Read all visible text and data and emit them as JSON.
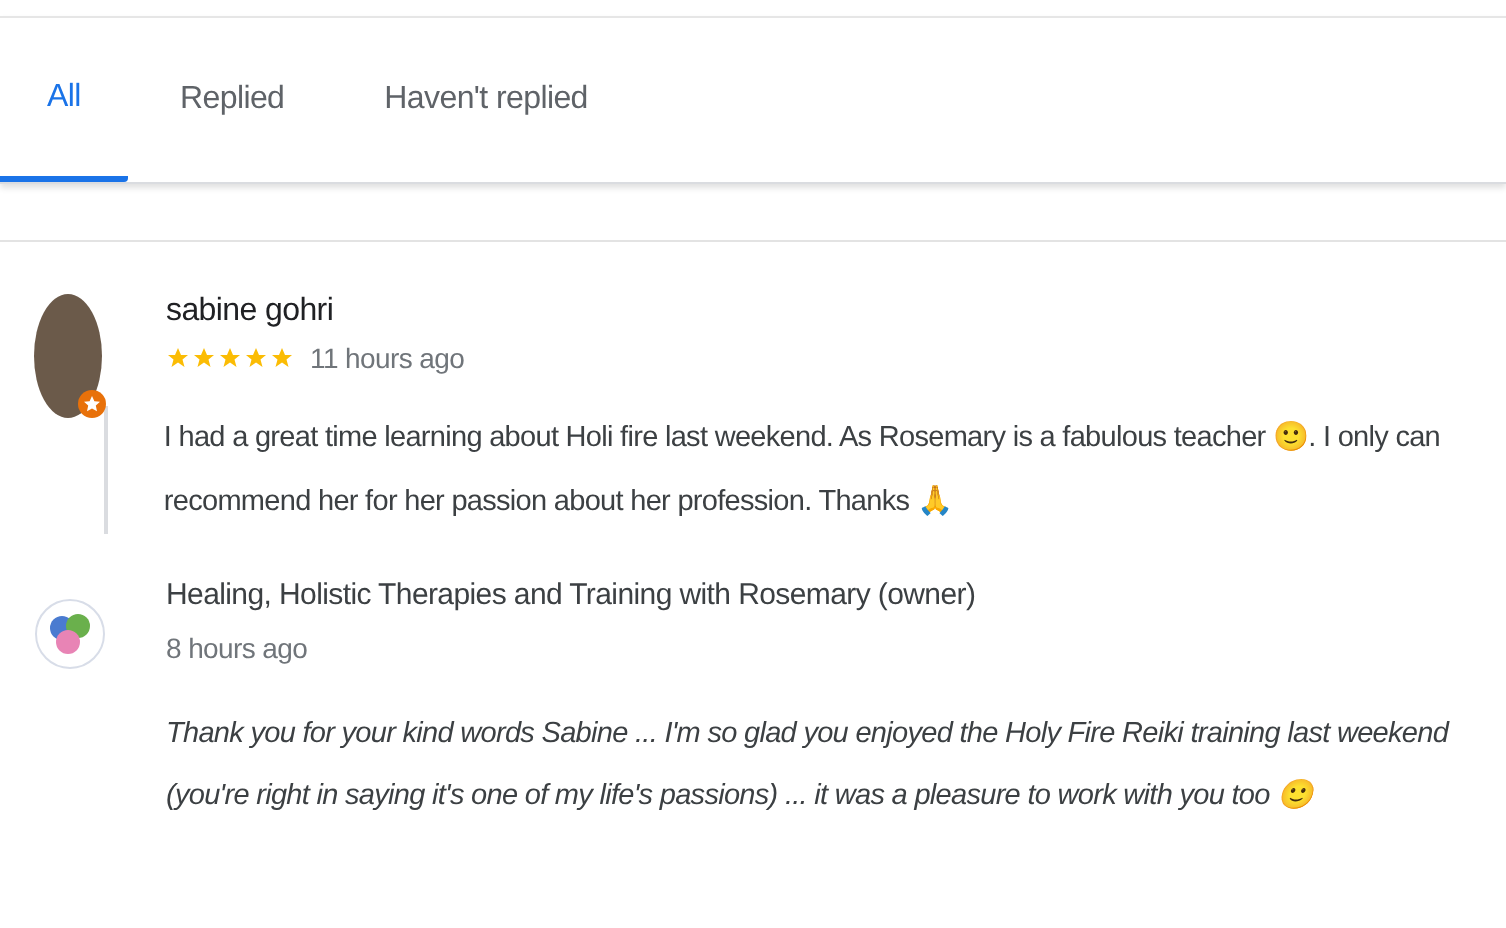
{
  "tabs": [
    {
      "label": "All",
      "selected": true
    },
    {
      "label": "Replied",
      "selected": false
    },
    {
      "label": "Haven't replied",
      "selected": false
    }
  ],
  "review": {
    "author": "sabine gohri",
    "stars": 5,
    "time": "11 hours ago",
    "text": "I had a great time learning about Holi fire last weekend. As Rosemary is a fabulous teacher 🙂. I only can recommend her for her passion about her profession. Thanks 🙏"
  },
  "reply": {
    "author": "Healing, Holistic Therapies and Training with Rosemary (owner)",
    "time": "8 hours ago",
    "text": "Thank you for your kind words Sabine ... I'm so glad you enjoyed the Holy Fire Reiki training last weekend (you're right in saying it's one of my life's passions) ... it was a pleasure to work with you too 🙂"
  }
}
